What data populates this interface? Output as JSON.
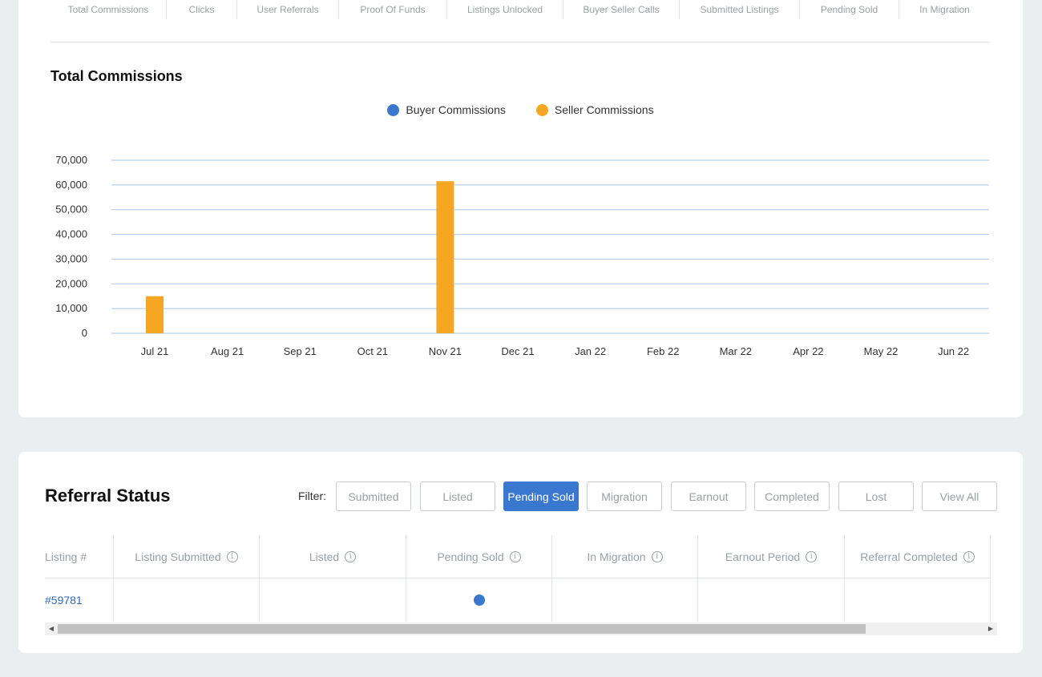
{
  "metric_tabs": [
    "Total Commissions",
    "Clicks",
    "User Referrals",
    "Proof Of Funds",
    "Listings Unlocked",
    "Buyer Seller Calls",
    "Submitted Listings",
    "Pending Sold",
    "In Migration"
  ],
  "chart_title": "Total Commissions",
  "legend": {
    "buyer": {
      "label": "Buyer Commissions",
      "color": "#3a78d0"
    },
    "seller": {
      "label": "Seller Commissions",
      "color": "#f5a623"
    }
  },
  "chart_data": {
    "type": "bar",
    "title": "Total Commissions",
    "categories": [
      "Jul 21",
      "Aug 21",
      "Sep 21",
      "Oct 21",
      "Nov 21",
      "Dec 21",
      "Jan 22",
      "Feb 22",
      "Mar 22",
      "Apr 22",
      "May 22",
      "Jun 22"
    ],
    "series": [
      {
        "name": "Buyer Commissions",
        "color": "#3a78d0",
        "values": [
          0,
          0,
          0,
          0,
          0,
          0,
          0,
          0,
          0,
          0,
          0,
          0
        ]
      },
      {
        "name": "Seller Commissions",
        "color": "#f5a623",
        "values": [
          15000,
          0,
          0,
          0,
          61500,
          0,
          0,
          0,
          0,
          0,
          0,
          0
        ]
      }
    ],
    "yticks": [
      "70,000",
      "60,000",
      "50,000",
      "40,000",
      "30,000",
      "20,000",
      "10,000",
      "0"
    ],
    "ylim": [
      0,
      70000
    ],
    "grid": true,
    "legend_position": "top-center"
  },
  "referral": {
    "title": "Referral Status",
    "filter_label": "Filter:",
    "filters": [
      {
        "label": "Submitted",
        "active": false
      },
      {
        "label": "Listed",
        "active": false
      },
      {
        "label": "Pending Sold",
        "active": true
      },
      {
        "label": "Migration",
        "active": false
      },
      {
        "label": "Earnout",
        "active": false
      },
      {
        "label": "Completed",
        "active": false
      },
      {
        "label": "Lost",
        "active": false
      },
      {
        "label": "View All",
        "active": false
      }
    ],
    "columns": [
      "Listing #",
      "Listing Submitted",
      "Listed",
      "Pending Sold",
      "In Migration",
      "Earnout Period",
      "Referral Completed"
    ],
    "rows": [
      {
        "listing": "#59781",
        "status_column": "Pending Sold"
      }
    ]
  }
}
